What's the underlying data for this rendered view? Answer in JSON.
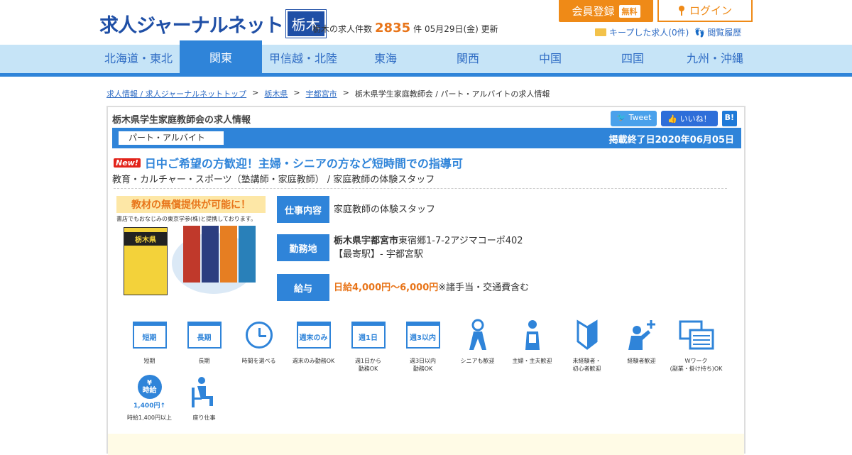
{
  "header": {
    "logo_text": "求人ジャーナルネット",
    "logo_region": "栃木",
    "count_prefix": "栃木の求人件数",
    "count_value": "2835",
    "count_suffix": "件 05月29日(金) 更新",
    "register_label": "会員登録",
    "free_badge": "無料",
    "login_label": "ログイン",
    "kept_label": "キープした求人(0件)",
    "history_label": "閲覧履歴"
  },
  "nav": {
    "items": [
      "北海道・東北",
      "関東",
      "甲信越・北陸",
      "東海",
      "関西",
      "中国",
      "四国",
      "九州・沖縄"
    ],
    "active": "関東"
  },
  "breadcrumb": {
    "items": [
      "求人情報 / 求人ジャーナルネットトップ",
      "栃木県",
      "宇都宮市"
    ],
    "current": "栃木県学生家庭教師会 / パート・アルバイトの求人情報"
  },
  "job": {
    "page_title": "栃木県学生家庭教師会の求人情報",
    "share": {
      "tweet": "Tweet",
      "like": "いいね！",
      "hatena": "B!"
    },
    "employment_type": "パート・アルバイト",
    "end_date": "掲載終了日2020年06月05日",
    "new_badge": "New!",
    "headline": "日中ご希望の方歓迎！主婦・シニアの方など短時間での指導可",
    "category": "教育・カルチャー・スポーツ（塾講師・家庭教師） / 家庭教師の体験スタッフ",
    "promo_title": "教材の無償提供が可能に！",
    "promo_sub": "書店でもおなじみの東京学参(株)と提携しております。",
    "promo_book": "栃木県",
    "rows": {
      "work_label": "仕事内容",
      "work_value": "家庭教師の体験スタッフ",
      "place_label": "勤務地",
      "place_city": "栃木県宇都宮市",
      "place_address": "東宿郷1-7-2アジマコーポ402",
      "place_station": "【最寄駅】- 宇都宮駅",
      "salary_label": "給与",
      "salary_value": "日給4,000円～6,000円",
      "salary_note": "※諸手当・交通費含む"
    }
  },
  "features": [
    {
      "icon": "short-term-icon",
      "box_text": "短期",
      "label": "短期"
    },
    {
      "icon": "long-term-icon",
      "box_text": "長期",
      "label": "長期"
    },
    {
      "icon": "clock-icon",
      "box_text": "",
      "label": "時間を選べる"
    },
    {
      "icon": "weekend-icon",
      "box_text": "週末のみ",
      "label": "週末のみ勤務OK"
    },
    {
      "icon": "one-day-week-icon",
      "box_text": "週1日",
      "label": "週1日から\n勤務OK"
    },
    {
      "icon": "three-days-week-icon",
      "box_text": "週3以内",
      "label": "週3日以内\n勤務OK"
    },
    {
      "icon": "senior-icon",
      "box_text": "",
      "label": "シニアも歓迎"
    },
    {
      "icon": "housewife-icon",
      "box_text": "",
      "label": "主婦・主夫歓迎"
    },
    {
      "icon": "beginner-icon",
      "box_text": "",
      "label": "未経験者・\n初心者歓迎"
    },
    {
      "icon": "experienced-icon",
      "box_text": "",
      "label": "経験者歓迎"
    },
    {
      "icon": "double-work-icon",
      "box_text": "",
      "label": "Ｗワーク\n(副業・掛け持ち)OK"
    }
  ],
  "features2": [
    {
      "icon": "hourly-wage-icon",
      "yen": "¥",
      "word": "時給",
      "amount": "1,400円↑",
      "label": "時給1,400円以上"
    },
    {
      "icon": "seated-work-icon",
      "label": "座り仕事"
    }
  ]
}
